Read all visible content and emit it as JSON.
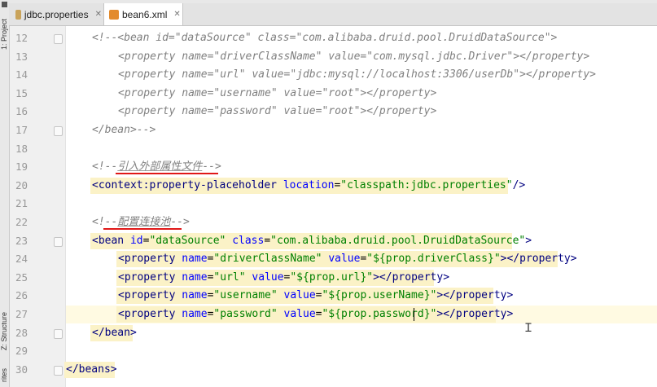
{
  "tabs": [
    {
      "label": "jdbc.properties",
      "active": false,
      "icon": "properties-file-icon"
    },
    {
      "label": "bean6.xml",
      "active": true,
      "icon": "xml-file-icon"
    }
  ],
  "side_tabs": {
    "project": "1: Project",
    "structure": "Z: Structure",
    "favorites": "rites"
  },
  "lines": [
    {
      "n": "12",
      "segs": [
        [
          "c",
          "<!--<bean id=\"dataSource\" class=\"com.alibaba.druid.pool.DruidDataSource\">"
        ]
      ]
    },
    {
      "n": "13",
      "segs": [
        [
          "c",
          "<property name=\"driverClassName\" value=\"com.mysql.jdbc.Driver\"></property>"
        ]
      ]
    },
    {
      "n": "14",
      "segs": [
        [
          "c",
          "<property name=\"url\" value=\"jdbc:mysql://localhost:3306/userDb\"></property>"
        ]
      ]
    },
    {
      "n": "15",
      "segs": [
        [
          "c",
          "<property name=\"username\" value=\"root\"></property>"
        ]
      ]
    },
    {
      "n": "16",
      "segs": [
        [
          "c",
          "<property name=\"password\" value=\"root\"></property>"
        ]
      ]
    },
    {
      "n": "17",
      "segs": [
        [
          "c",
          "</bean>-->"
        ]
      ]
    },
    {
      "n": "18",
      "segs": []
    },
    {
      "n": "19",
      "segs": [
        [
          "c",
          "<!--"
        ],
        [
          "cz",
          "引入外部属性文件"
        ],
        [
          "c",
          "-->"
        ]
      ]
    },
    {
      "n": "20",
      "segs": [
        [
          "t",
          "<context:property-placeholder "
        ],
        [
          "a",
          "location"
        ],
        [
          "p",
          "="
        ],
        [
          "v",
          "\"classpath:jdbc.properties\""
        ],
        [
          "t",
          "/>"
        ]
      ]
    },
    {
      "n": "21",
      "segs": []
    },
    {
      "n": "22",
      "segs": [
        [
          "c",
          "<!--"
        ],
        [
          "cz",
          "配置连接池"
        ],
        [
          "c",
          "-->"
        ]
      ]
    },
    {
      "n": "23",
      "segs": [
        [
          "t",
          "<bean "
        ],
        [
          "a",
          "id"
        ],
        [
          "p",
          "="
        ],
        [
          "v",
          "\"dataSource\" "
        ],
        [
          "a",
          "class"
        ],
        [
          "p",
          "="
        ],
        [
          "v",
          "\"com.alibaba.druid.pool.DruidDataSource\""
        ],
        [
          "t",
          ">"
        ]
      ]
    },
    {
      "n": "24",
      "segs": [
        [
          "t",
          "<property "
        ],
        [
          "a",
          "name"
        ],
        [
          "p",
          "="
        ],
        [
          "v",
          "\"driverClassName\" "
        ],
        [
          "a",
          "value"
        ],
        [
          "p",
          "="
        ],
        [
          "v",
          "\"${prop.driverClass}\""
        ],
        [
          "t",
          "></property>"
        ]
      ]
    },
    {
      "n": "25",
      "segs": [
        [
          "t",
          "<property "
        ],
        [
          "a",
          "name"
        ],
        [
          "p",
          "="
        ],
        [
          "v",
          "\"url\" "
        ],
        [
          "a",
          "value"
        ],
        [
          "p",
          "="
        ],
        [
          "v",
          "\"${prop.url}\""
        ],
        [
          "t",
          "></property>"
        ]
      ]
    },
    {
      "n": "26",
      "segs": [
        [
          "t",
          "<property "
        ],
        [
          "a",
          "name"
        ],
        [
          "p",
          "="
        ],
        [
          "v",
          "\"username\" "
        ],
        [
          "a",
          "value"
        ],
        [
          "p",
          "="
        ],
        [
          "v",
          "\"${prop.userName}\""
        ],
        [
          "t",
          "></property>"
        ]
      ]
    },
    {
      "n": "27",
      "segs": [
        [
          "t",
          "<property "
        ],
        [
          "a",
          "name"
        ],
        [
          "p",
          "="
        ],
        [
          "v",
          "\"password\" "
        ],
        [
          "a",
          "value"
        ],
        [
          "p",
          "="
        ],
        [
          "v",
          "\"${prop.password}\""
        ],
        [
          "t",
          "></property>"
        ]
      ]
    },
    {
      "n": "28",
      "segs": [
        [
          "t",
          "</bean>"
        ]
      ]
    },
    {
      "n": "29",
      "segs": []
    },
    {
      "n": "30",
      "segs": [
        [
          "t",
          "</beans>"
        ]
      ]
    }
  ],
  "colors": {
    "tag": "#000080",
    "attribute": "#0000ff",
    "string": "#008000",
    "comment": "#808080",
    "highlight": "#fbf2c7",
    "annotation_underline": "#e01818"
  }
}
